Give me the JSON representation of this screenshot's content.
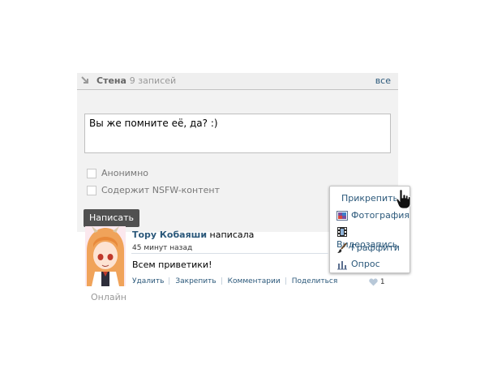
{
  "wall": {
    "title": "Стена",
    "count": "9 записей",
    "all_link": "все"
  },
  "compose": {
    "text_value": "Вы же помните её, да? :)",
    "anonymous_label": "Анонимно",
    "nsfw_label": "Содержит NSFW-контент",
    "submit_label": "Написать"
  },
  "attach_menu": {
    "header": "Прикрепить",
    "items": [
      {
        "label": "Фотография",
        "icon": "photo-icon"
      },
      {
        "label": "Видеозапись",
        "icon": "video-icon"
      },
      {
        "label": "Граффити",
        "icon": "brush-icon"
      },
      {
        "label": "Опрос",
        "icon": "poll-icon"
      }
    ]
  },
  "post": {
    "author": "Тору Кобаяши",
    "verb": "написала",
    "time": "45 минут назад",
    "text": "Всем приветики!",
    "actions": [
      "Удалить",
      "Закрепить",
      "Комментарии",
      "Поделиться"
    ],
    "likes": "1",
    "status": "Онлайн"
  },
  "colors": {
    "link": "#2b587a",
    "button_bg": "#505050",
    "panel_bg": "#f2f2f2"
  }
}
